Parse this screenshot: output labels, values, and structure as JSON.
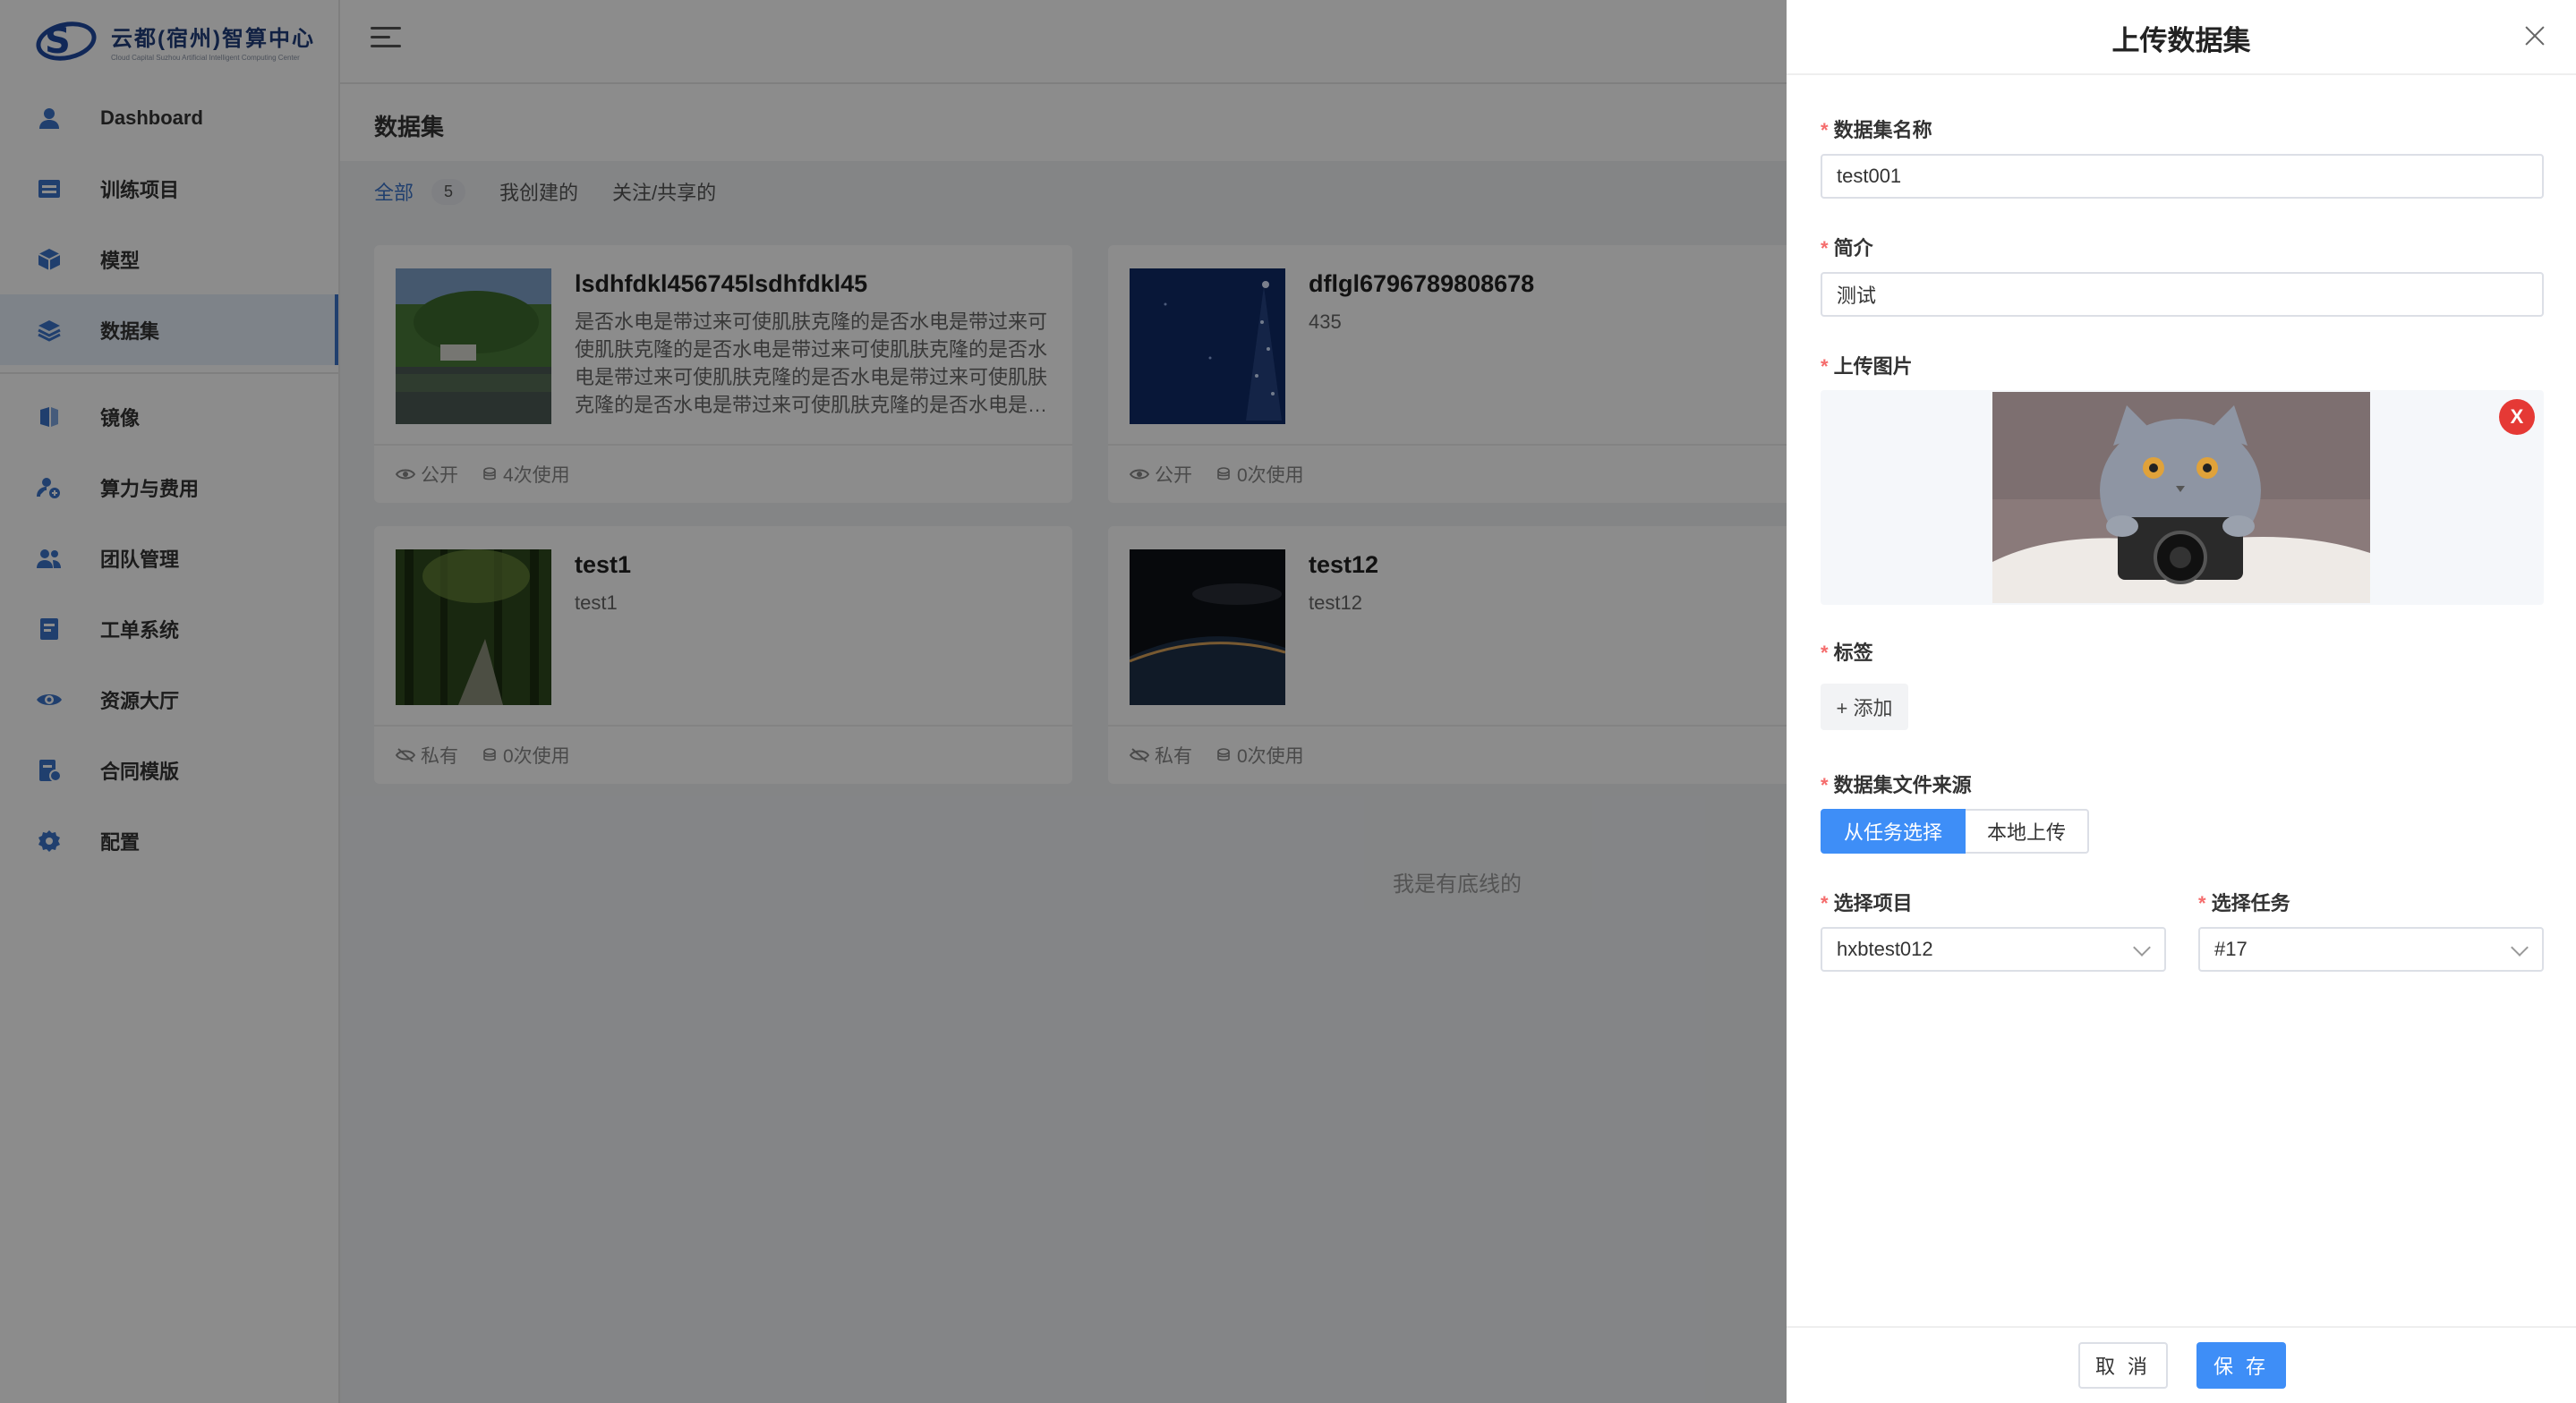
{
  "logo": {
    "title": "云都(宿州)智算中心",
    "subtitle": "Cloud Capital Suzhou Artificial Intelligent Computing Center"
  },
  "sidebar": {
    "items": [
      {
        "label": "Dashboard",
        "icon": "user-icon"
      },
      {
        "label": "训练项目",
        "icon": "project-icon"
      },
      {
        "label": "模型",
        "icon": "cube-icon"
      },
      {
        "label": "数据集",
        "icon": "layers-icon",
        "active": true
      },
      {
        "label": "镜像",
        "icon": "image-icon"
      },
      {
        "label": "算力与费用",
        "icon": "compute-icon"
      },
      {
        "label": "团队管理",
        "icon": "team-icon"
      },
      {
        "label": "工单系统",
        "icon": "ticket-icon"
      },
      {
        "label": "资源大厅",
        "icon": "eye-icon"
      },
      {
        "label": "合同模版",
        "icon": "contract-icon"
      },
      {
        "label": "配置",
        "icon": "gear-icon"
      }
    ]
  },
  "main": {
    "title": "数据集",
    "tabs": [
      {
        "label": "全部",
        "count": "5"
      },
      {
        "label": "我创建的"
      },
      {
        "label": "关注/共享的"
      }
    ],
    "cards": [
      {
        "name": "lsdhfdkl456745lsdhfdkl45",
        "desc": "是否水电是带过来可使肌肤克隆的是否水电是带过来可使肌肤克隆的是否水电是带过来可使肌肤克隆的是否水电是带过来可使肌肤克隆的是否水电是带过来可使肌肤克隆的是否水电是带过来可使肌肤克隆的是否水电是…",
        "visibility": "公开",
        "usage": "4次使用"
      },
      {
        "name": "dflgl6796789808678",
        "desc": "435",
        "visibility": "公开",
        "usage": "0次使用"
      },
      {
        "name": "test1",
        "desc": "test1",
        "visibility": "私有",
        "usage": "0次使用"
      },
      {
        "name": "test12",
        "desc": "test12",
        "visibility": "私有",
        "usage": "0次使用"
      }
    ],
    "bottom_text": "我是有底线的"
  },
  "drawer": {
    "title": "上传数据集",
    "fields": {
      "name_label": "数据集名称",
      "name_value": "test001",
      "intro_label": "简介",
      "intro_value": "测试",
      "image_label": "上传图片",
      "remove_label": "X",
      "tags_label": "标签",
      "add_tag": "+ 添加",
      "source_label": "数据集文件来源",
      "source_options": [
        "从任务选择",
        "本地上传"
      ],
      "project_label": "选择项目",
      "project_value": "hxbtest012",
      "task_label": "选择任务",
      "task_value": "#17"
    },
    "footer": {
      "cancel": "取 消",
      "save": "保 存"
    }
  }
}
